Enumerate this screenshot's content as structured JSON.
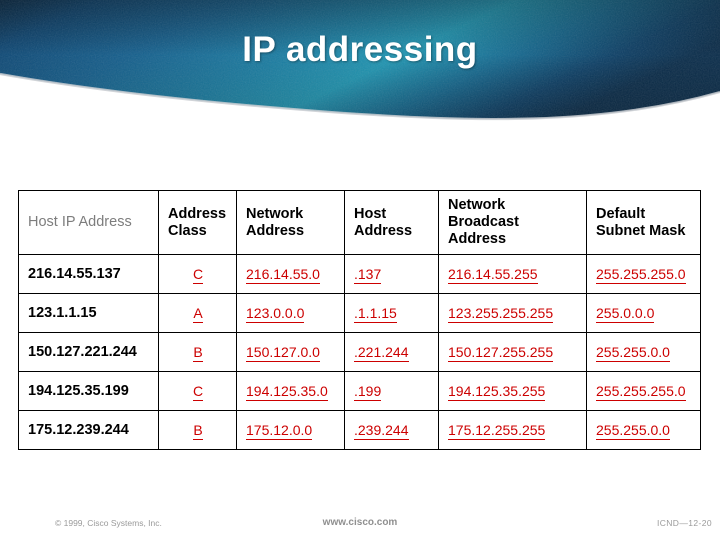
{
  "slide": {
    "title": "IP addressing",
    "banner": {
      "color_dark": "#0b3a5e",
      "color_mid": "#15628c",
      "color_light": "#1f90ad",
      "title_color": "#ffffff"
    }
  },
  "table": {
    "accent_color": "#cc0000",
    "headers": [
      "Host IP Address",
      "Address Class",
      "Network Address",
      "Host Address",
      "Network Broadcast Address",
      "Default Subnet Mask"
    ],
    "rows": [
      {
        "host_ip_address": "216.14.55.137",
        "address_class": "C",
        "network_address": "216.14.55.0",
        "host_address": ".137",
        "network_broadcast_address": "216.14.55.255",
        "default_subnet_mask": "255.255.255.0"
      },
      {
        "host_ip_address": "123.1.1.15",
        "address_class": "A",
        "network_address": "123.0.0.0",
        "host_address": ".1.1.15",
        "network_broadcast_address": "123.255.255.255",
        "default_subnet_mask": "255.0.0.0"
      },
      {
        "host_ip_address": "150.127.221.244",
        "address_class": "B",
        "network_address": "150.127.0.0",
        "host_address": ".221.244",
        "network_broadcast_address": "150.127.255.255",
        "default_subnet_mask": "255.255.0.0"
      },
      {
        "host_ip_address": "194.125.35.199",
        "address_class": "C",
        "network_address": "194.125.35.0",
        "host_address": ".199",
        "network_broadcast_address": "194.125.35.255",
        "default_subnet_mask": "255.255.255.0"
      },
      {
        "host_ip_address": "175.12.239.244",
        "address_class": "B",
        "network_address": "175.12.0.0",
        "host_address": ".239.244",
        "network_broadcast_address": "175.12.255.255",
        "default_subnet_mask": "255.255.0.0"
      }
    ]
  },
  "footer": {
    "copyright": "© 1999, Cisco Systems, Inc.",
    "url": "www.cisco.com",
    "slide_id": "ICND—12-20"
  }
}
